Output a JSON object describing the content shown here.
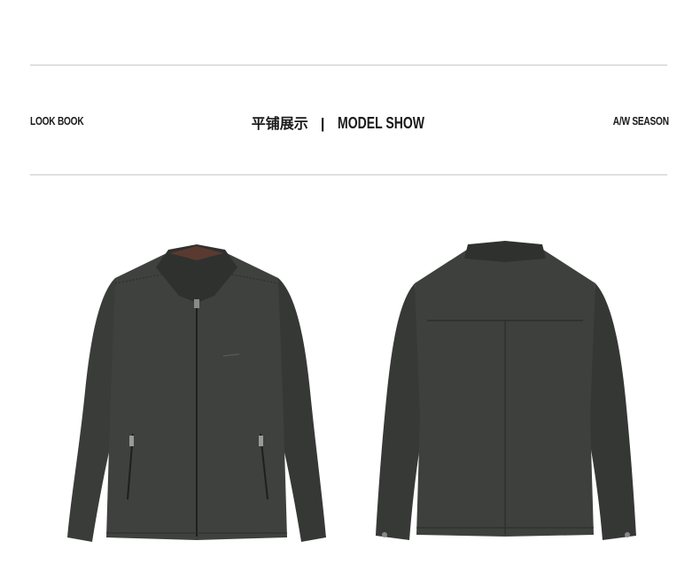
{
  "header": {
    "left_label": "LOOK BOOK",
    "title_cn": "平铺展示",
    "separator": "|",
    "title_en": "MODEL SHOW",
    "right_label": "A/W SEASON"
  },
  "images": {
    "front": "jacket-front-view",
    "back": "jacket-back-view"
  },
  "colors": {
    "leather": "#3b3d3b",
    "leather_dark": "#2a2c2a",
    "rule": "#c9c9c9",
    "background": "#ffffff"
  }
}
